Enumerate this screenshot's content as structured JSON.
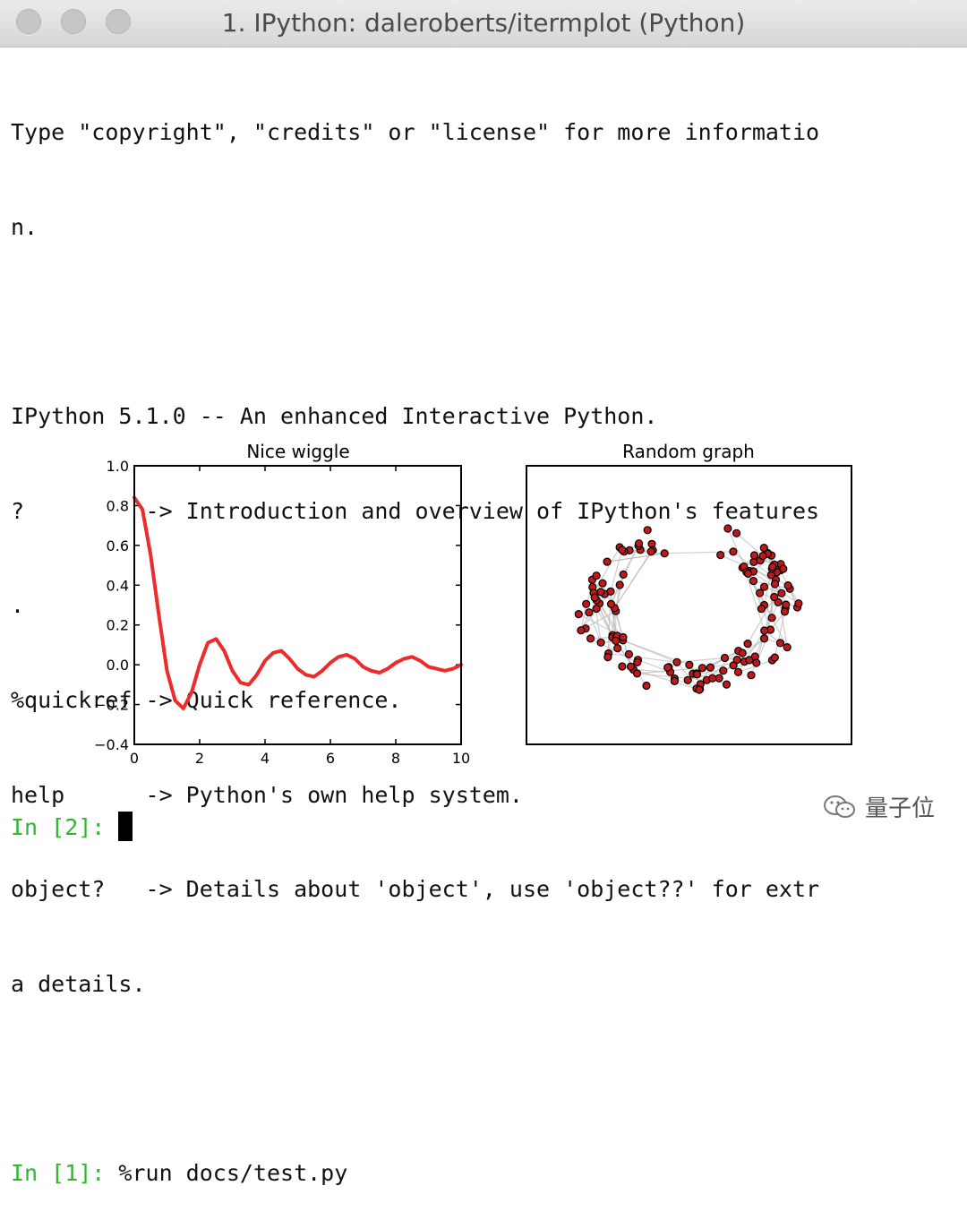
{
  "window": {
    "title": "1. IPython: daleroberts/itermplot (Python)"
  },
  "terminal": {
    "lines": [
      "Type \"copyright\", \"credits\" or \"license\" for more informatio",
      "n.",
      "",
      "IPython 5.1.0 -- An enhanced Interactive Python.",
      "?         -> Introduction and overview of IPython's features",
      ".",
      "%quickref -> Quick reference.",
      "help      -> Python's own help system.",
      "object?   -> Details about 'object', use 'object??' for extr",
      "a details.",
      ""
    ],
    "prompt1": {
      "label": "In [1]:",
      "command": " %run docs/test.py"
    },
    "prompt2": {
      "label": "In [2]:"
    }
  },
  "chart_data": [
    {
      "type": "line",
      "title": "Nice wiggle",
      "xlabel": "",
      "ylabel": "",
      "xlim": [
        0,
        10
      ],
      "ylim": [
        -0.4,
        1.0
      ],
      "xticks": [
        0,
        2,
        4,
        6,
        8,
        10
      ],
      "yticks": [
        -0.4,
        -0.2,
        0.0,
        0.2,
        0.4,
        0.6,
        0.8,
        1.0
      ],
      "xtick_labels": [
        "0",
        "2",
        "4",
        "6",
        "8",
        "10"
      ],
      "ytick_labels": [
        "−0.4",
        "−0.2",
        "0.0",
        "0.2",
        "0.4",
        "0.6",
        "0.8",
        "1.0"
      ],
      "line_color": "#ee2a2a",
      "series": [
        {
          "x": [
            0,
            0.25,
            0.5,
            0.75,
            1.0,
            1.25,
            1.5,
            1.75,
            2.0,
            2.25,
            2.5,
            2.75,
            3.0,
            3.25,
            3.5,
            3.75,
            4.0,
            4.25,
            4.5,
            4.75,
            5.0,
            5.25,
            5.5,
            5.75,
            6.0,
            6.25,
            6.5,
            6.75,
            7.0,
            7.25,
            7.5,
            7.75,
            8.0,
            8.25,
            8.5,
            8.75,
            9.0,
            9.25,
            9.5,
            9.75,
            10.0
          ],
          "y": [
            0.84,
            0.78,
            0.55,
            0.25,
            -0.03,
            -0.18,
            -0.22,
            -0.14,
            0.0,
            0.11,
            0.13,
            0.07,
            -0.03,
            -0.09,
            -0.1,
            -0.05,
            0.02,
            0.06,
            0.07,
            0.03,
            -0.02,
            -0.05,
            -0.06,
            -0.03,
            0.01,
            0.04,
            0.05,
            0.03,
            -0.01,
            -0.03,
            -0.04,
            -0.02,
            0.01,
            0.03,
            0.04,
            0.02,
            -0.01,
            -0.02,
            -0.03,
            -0.02,
            0.0
          ]
        }
      ]
    },
    {
      "type": "scatter",
      "title": "Random graph",
      "node_color": "#c0191a",
      "edge_color": "#bbbbbb"
    }
  ],
  "watermark": {
    "text": "量子位",
    "icon": "wechat-icon"
  }
}
